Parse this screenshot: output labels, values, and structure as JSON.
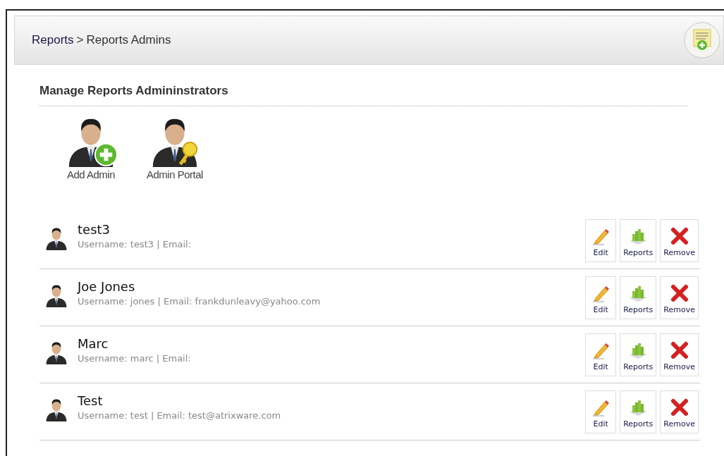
{
  "breadcrumb": {
    "parent": "Reports",
    "separator": ">",
    "current": "Reports Admins"
  },
  "section_title": "Manage Reports Admininstrators",
  "actions": [
    {
      "kind": "add",
      "label": "Add Admin"
    },
    {
      "kind": "portal",
      "label": "Admin Portal"
    }
  ],
  "admins": [
    {
      "name": "test3",
      "details": "Username: test3 | Email:",
      "buttons": [
        "Edit",
        "Reports",
        "Remove"
      ]
    },
    {
      "name": "Joe Jones",
      "details": "Username: jones | Email: frankdunleavy@yahoo.com",
      "buttons": [
        "Edit",
        "Reports",
        "Remove"
      ]
    },
    {
      "name": "Marc",
      "details": "Username: marc | Email:",
      "buttons": [
        "Edit",
        "Reports",
        "Remove"
      ]
    },
    {
      "name": "Test",
      "details": "Username: test | Email: test@atrixware.com",
      "buttons": [
        "Edit",
        "Reports",
        "Remove"
      ]
    }
  ]
}
